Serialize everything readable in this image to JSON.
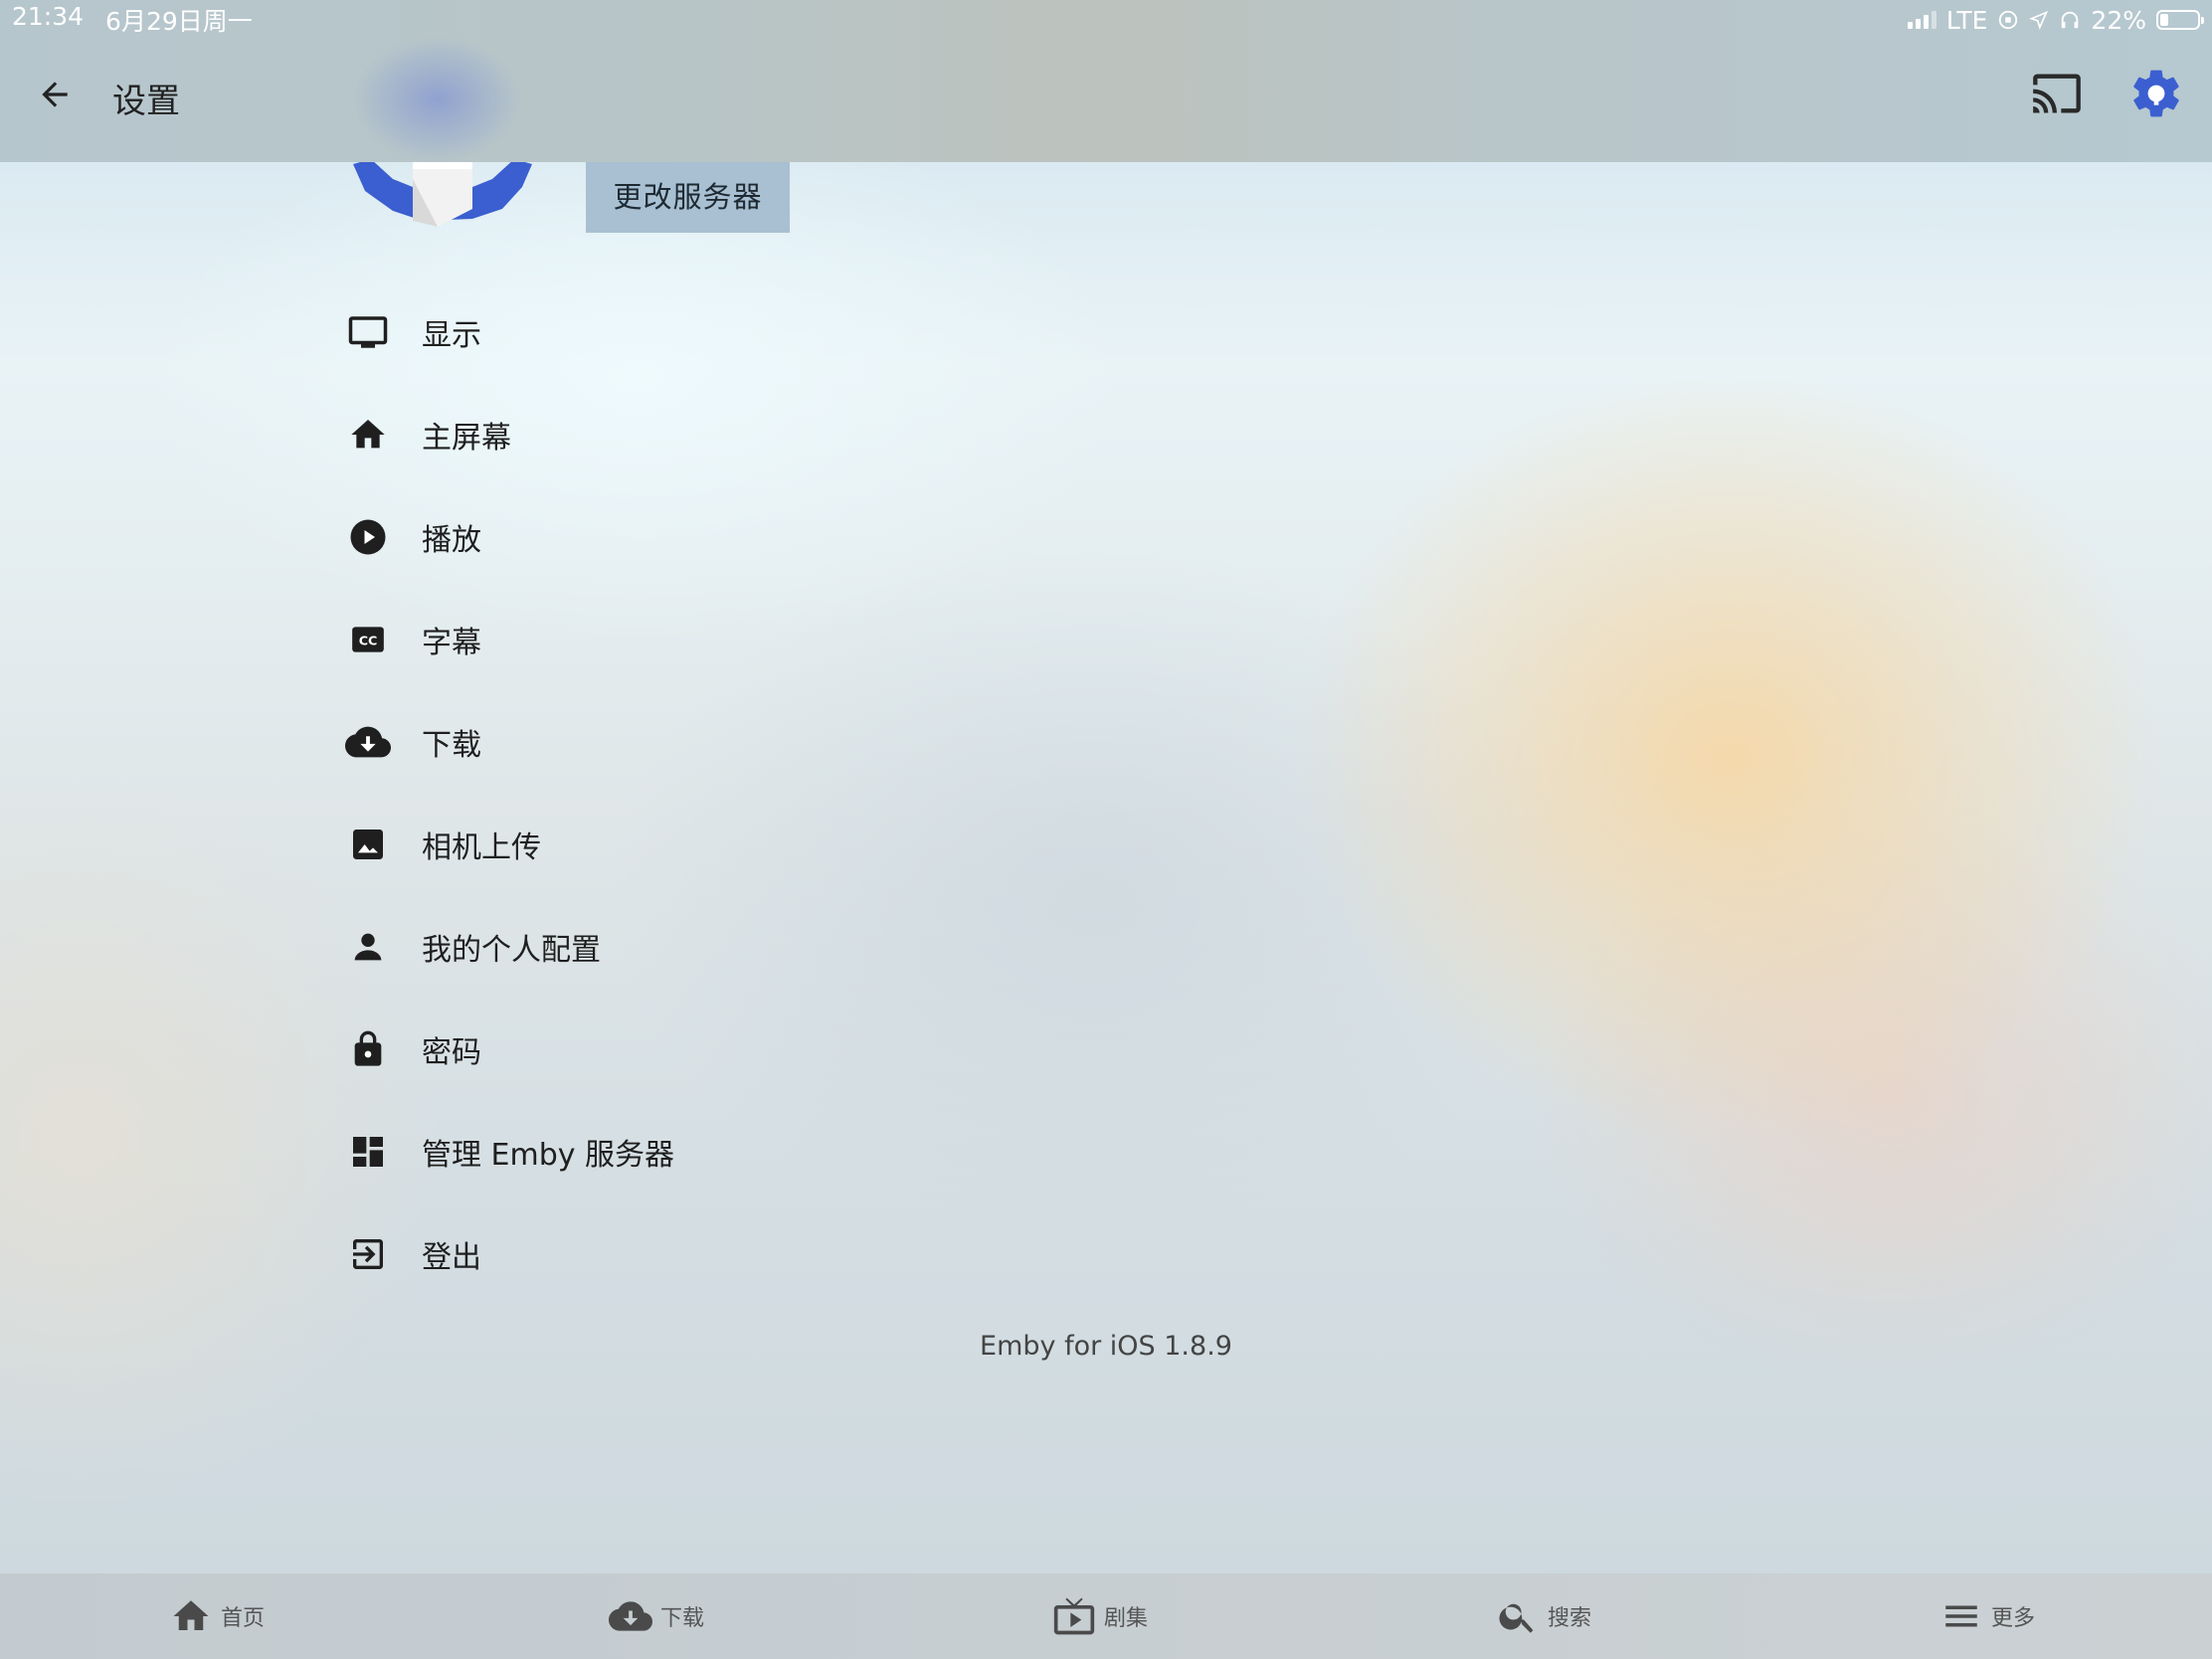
{
  "status_bar": {
    "time": "21:34",
    "date": "6月29日周一",
    "network": "LTE",
    "battery_text": "22%",
    "battery_level": 0.22
  },
  "header": {
    "title": "设置",
    "back_icon": "arrow-left-icon",
    "cast_icon": "cast-icon",
    "settings_icon": "settings-gear-icon",
    "accent_color": "#3b5fd0"
  },
  "server": {
    "change_server_label": "更改服务器"
  },
  "menu": {
    "items": [
      {
        "label": "显示",
        "icon": "monitor-icon"
      },
      {
        "label": "主屏幕",
        "icon": "home-icon"
      },
      {
        "label": "播放",
        "icon": "play-circle-icon"
      },
      {
        "label": "字幕",
        "icon": "closed-caption-icon"
      },
      {
        "label": "下载",
        "icon": "cloud-download-icon"
      },
      {
        "label": "相机上传",
        "icon": "image-icon"
      },
      {
        "label": "我的个人配置",
        "icon": "person-icon"
      },
      {
        "label": "密码",
        "icon": "lock-icon"
      },
      {
        "label": "管理 Emby 服务器",
        "icon": "dashboard-icon"
      },
      {
        "label": "登出",
        "icon": "exit-icon"
      }
    ]
  },
  "footer": {
    "version": "Emby for iOS 1.8.9"
  },
  "bottom_nav": {
    "items": [
      {
        "label": "首页",
        "icon": "home-icon"
      },
      {
        "label": "下载",
        "icon": "cloud-download-icon"
      },
      {
        "label": "剧集",
        "icon": "tv-play-icon"
      },
      {
        "label": "搜索",
        "icon": "search-icon"
      },
      {
        "label": "更多",
        "icon": "menu-icon"
      }
    ]
  }
}
